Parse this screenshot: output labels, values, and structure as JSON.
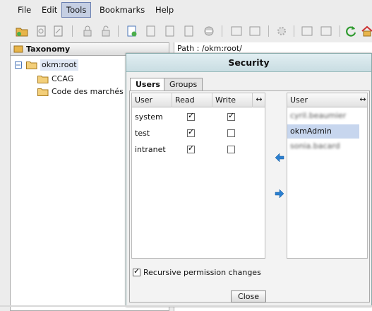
{
  "menubar": {
    "items": [
      {
        "label": "File"
      },
      {
        "label": "Edit"
      },
      {
        "label": "Tools"
      },
      {
        "label": "Bookmarks"
      },
      {
        "label": "Help"
      }
    ]
  },
  "taxonomy": {
    "title": "Taxonomy",
    "root": "okm:root",
    "children": [
      "CCAG",
      "Code des marchés"
    ]
  },
  "right_panel": {
    "path_label": "Path : /okm:root/"
  },
  "dialog": {
    "title": "Security",
    "tabs": [
      "Users",
      "Groups"
    ],
    "left_grid": {
      "headers": [
        "User",
        "Read",
        "Write"
      ],
      "rows": [
        {
          "user": "system",
          "read": true,
          "write": true
        },
        {
          "user": "test",
          "read": true,
          "write": false
        },
        {
          "user": "intranet",
          "read": true,
          "write": false
        }
      ]
    },
    "right_grid": {
      "header": "User",
      "rows": [
        {
          "user": "cyril.beaumier",
          "blurred": true
        },
        {
          "user": "okmAdmin",
          "blurred": false
        },
        {
          "user": "sonia.bacard",
          "blurred": true
        }
      ]
    },
    "recursive_label": "Recursive permission changes",
    "recursive_checked": true,
    "close_label": "Close"
  },
  "colors": {
    "accent": "#2b7fd0",
    "folder": "#e8b54a",
    "selection": "#c7d6ee"
  }
}
